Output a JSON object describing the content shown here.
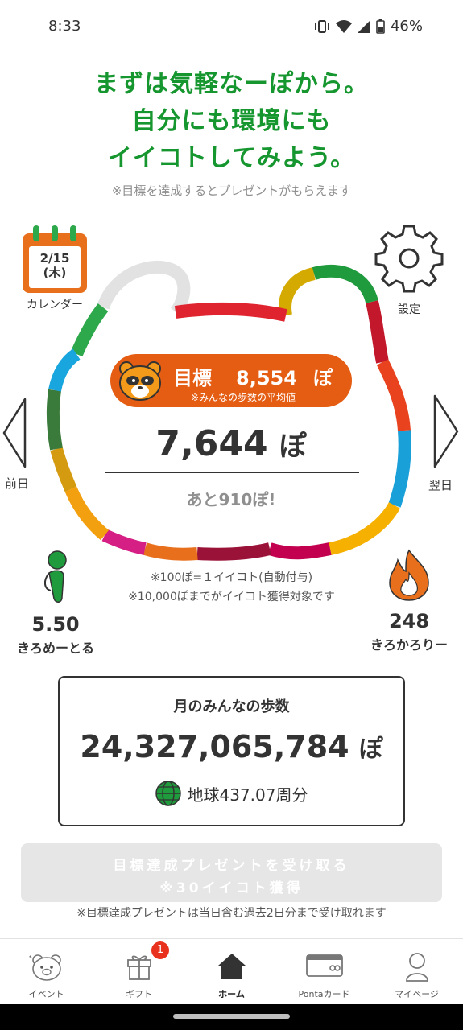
{
  "status": {
    "time": "8:33",
    "battery": "46%"
  },
  "headline": {
    "line1": "まずは気軽なーぽから。",
    "line2": "自分にも環境にも",
    "line3": "イイコトしてみよう。"
  },
  "subnote": "※目標を達成するとプレゼントがもらえます",
  "calendar": {
    "date": "2/15",
    "weekday": "(木)",
    "label": "カレンダー"
  },
  "settings": {
    "label": "設定"
  },
  "nav": {
    "prev": "前日",
    "next": "翌日"
  },
  "goal": {
    "label": "目標",
    "value": "8,554",
    "unit": "ぽ",
    "note": "※みんなの歩数の平均値"
  },
  "steps": {
    "value": "7,644",
    "unit": "ぽ",
    "remaining": "あと910ぽ!"
  },
  "note_center": {
    "line1": "※100ぽ=１イイコト(自動付与)",
    "line2": "※10,000ぽまでがイイコト獲得対象です"
  },
  "stats": {
    "meters_value": "5.50",
    "meters_label": "きろめーとる",
    "calories_value": "248",
    "calories_label": "きろかろりー"
  },
  "monthly": {
    "title": "月のみんなの歩数",
    "value": "24,327,065,784",
    "unit": "ぽ",
    "earth": "地球437.07周分"
  },
  "present": {
    "line1": "目標達成プレゼントを受け取る",
    "line2": "※30イイコト獲得",
    "note": "※目標達成プレゼントは当日含む過去2日分まで受け取れます"
  },
  "tabs": [
    {
      "label": "イベント",
      "icon": "bear-icon"
    },
    {
      "label": "ギフト",
      "icon": "gift-icon",
      "badge": "1"
    },
    {
      "label": "ホーム",
      "icon": "home-icon",
      "active": true
    },
    {
      "label": "Pontaカード",
      "icon": "card-icon"
    },
    {
      "label": "マイページ",
      "icon": "person-icon"
    }
  ],
  "colors": {
    "brand_green": "#16962f",
    "goal_orange": "#e45d13",
    "flame_orange": "#e8701d"
  }
}
